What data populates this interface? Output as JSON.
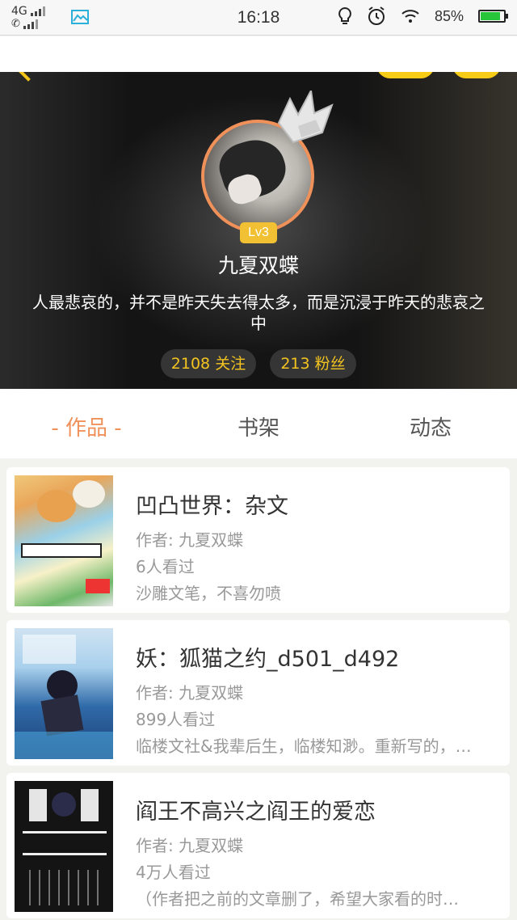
{
  "status_bar": {
    "network_label": "4G",
    "time": "16:18",
    "battery": "85%",
    "battery_level": 0.85,
    "icons": [
      "signal-icon",
      "call-signal-icon",
      "gallery-icon",
      "bulb-icon",
      "alarm-icon",
      "wifi-icon",
      "battery-icon"
    ]
  },
  "profile": {
    "level": "Lv3",
    "nickname": "九夏双蝶",
    "signature": "人最悲哀的，并不是昨天失去得太多，而是沉浸于昨天的悲哀之中",
    "following": "2108 关注",
    "followers": "213 粉丝"
  },
  "tabs": [
    {
      "label": "作品",
      "active": true
    },
    {
      "label": "书架",
      "active": false
    },
    {
      "label": "动态",
      "active": false
    }
  ],
  "tab_active_decor": "- 作品 -",
  "works": [
    {
      "title": "凹凸世界：杂文",
      "author": "作者: 九夏双蝶",
      "views": "6人看过",
      "summary": "沙雕文笔，不喜勿喷"
    },
    {
      "title": "妖：狐猫之约_d501_d492",
      "author": "作者: 九夏双蝶",
      "views": "899人看过",
      "summary": "临楼文社&我辈后生，临楼知渺。重新写的，…"
    },
    {
      "title": "阎王不高兴之阎王的爱恋",
      "author": "作者: 九夏双蝶",
      "views": "4万人看过",
      "summary": "（作者把之前的文章删了，希望大家看的时…"
    }
  ],
  "colors": {
    "accent": "#f0915a",
    "gold": "#f3c420",
    "text": "#333333",
    "muted": "#999999"
  }
}
